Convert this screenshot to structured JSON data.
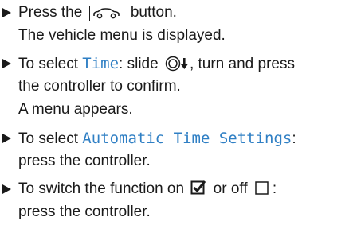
{
  "steps": [
    {
      "text_a": "Press the",
      "button_icon": "vehicle-button-icon",
      "text_b": "button.",
      "result": "The vehicle menu is displayed."
    },
    {
      "prefix": "To select",
      "option": "Time",
      "colon": ":",
      "text_a": "slide",
      "controller_icon": "controller-slide-down-icon",
      "text_b": ", turn and press",
      "line2": "the controller to confirm.",
      "result": "A menu appears."
    },
    {
      "prefix": "To select",
      "option": "Automatic Time Settings",
      "colon": ":",
      "line2": "press the controller."
    },
    {
      "text_a": "To switch the function on",
      "checked_icon": "checkbox-checked-icon",
      "text_b": "or off",
      "unchecked_icon": "checkbox-unchecked-icon",
      "text_c": ":",
      "line2": "press the controller."
    }
  ],
  "colors": {
    "text": "#1a1a1a",
    "highlight": "#2f7fc4"
  }
}
